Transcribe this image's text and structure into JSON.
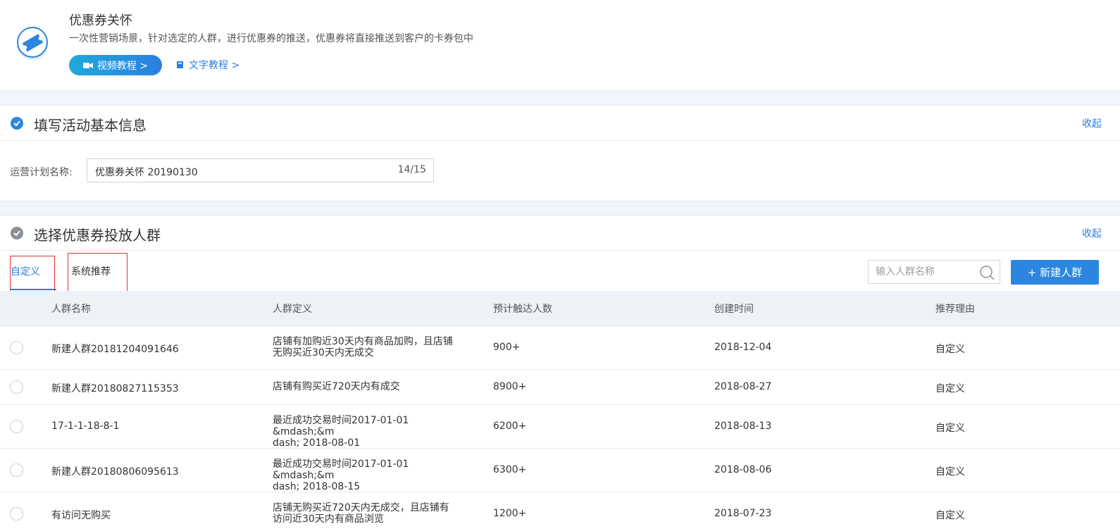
{
  "header": {
    "title": "优惠券关怀",
    "description": "一次性营销场景，针对选定的人群，进行优惠券的推送，优惠券将直接推送到客户的卡券包中",
    "video_label": "视频教程 >",
    "text_label": "文字教程 >"
  },
  "section1": {
    "title": "填写活动基本信息",
    "collapse": "收起"
  },
  "plan": {
    "label": "运营计划名称:",
    "value": "优惠券关怀 20190130",
    "count": "14/15"
  },
  "section2": {
    "title": "选择优惠券投放人群",
    "collapse": "收起"
  },
  "tabs": [
    {
      "label": "自定义"
    },
    {
      "label": "系统推荐"
    }
  ],
  "search": {
    "placeholder": "输入人群名称"
  },
  "new_button": "+ 新建人群",
  "table": {
    "headers": [
      "人群名称",
      "人群定义",
      "预计触达人数",
      "创建时间",
      "推荐理由"
    ],
    "rows": [
      {
        "name": "新建人群20181204091646",
        "def1": "店铺有加购近30天内有商品加购，且店铺",
        "def2": "无购买近30天内无成交",
        "count": "900+",
        "date": "2018-12-04",
        "reason": "自定义"
      },
      {
        "name": "新建人群20180827115353",
        "def1": "店铺有购买近720天内有成交",
        "def2": "",
        "count": "8900+",
        "date": "2018-08-27",
        "reason": "自定义"
      },
      {
        "name": "17-1-1-18-8-1",
        "def1": "最近成功交易时间2017-01-01 &mdash;&m",
        "def2": "dash; 2018-08-01",
        "count": "6200+",
        "date": "2018-08-13",
        "reason": "自定义"
      },
      {
        "name": "新建人群20180806095613",
        "def1": "最近成功交易时间2017-01-01 &mdash;&m",
        "def2": "dash; 2018-08-15",
        "count": "6300+",
        "date": "2018-08-06",
        "reason": "自定义"
      },
      {
        "name": "有访问无购买",
        "def1": "店铺无购买近720天内无成交，且店铺有",
        "def2": "访问近30天内有商品浏览",
        "count": "1200+",
        "date": "2018-07-23",
        "reason": "自定义"
      }
    ]
  },
  "colors": {
    "accent": "#2b7fe0",
    "check_active": "#2b86e0",
    "check_inactive": "#8a8f96",
    "highlight": "#e23030"
  }
}
